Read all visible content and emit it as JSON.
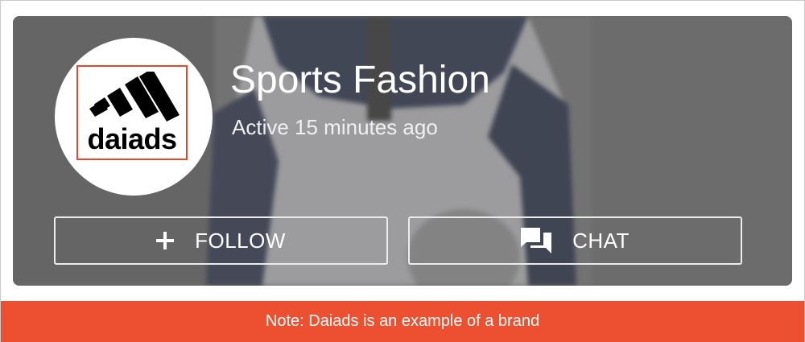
{
  "shop": {
    "name": "Sports Fashion",
    "status": "Active 15 minutes ago",
    "logo": {
      "wordmark": "daiads",
      "icon": "three-stripes-logo-icon",
      "frame_color": "#e04a2a"
    }
  },
  "actions": {
    "follow": {
      "label": "FOLLOW",
      "icon": "plus-icon"
    },
    "chat": {
      "label": "CHAT",
      "icon": "chat-bubbles-icon"
    }
  },
  "note": {
    "text": "Note: Daiads is an example of a brand",
    "color": "#ec5030"
  }
}
